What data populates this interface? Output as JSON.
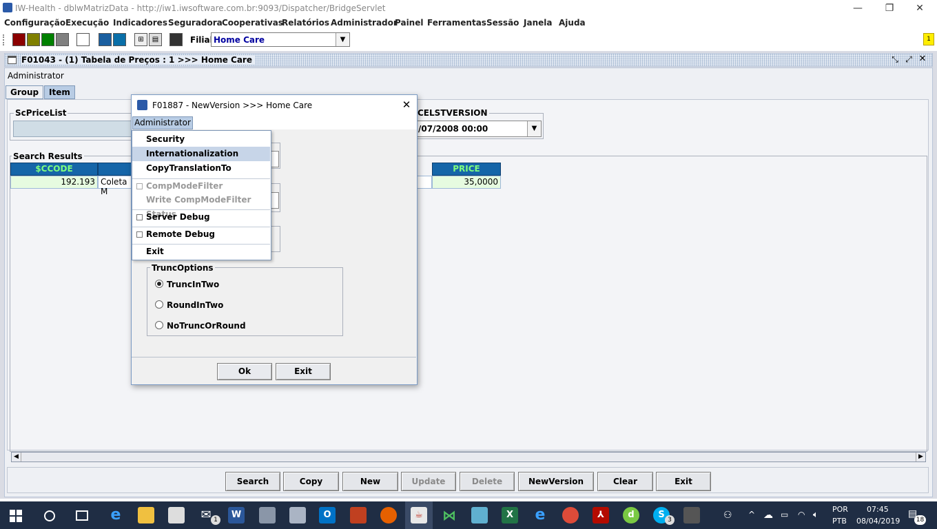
{
  "window": {
    "title": "IW-Health - dblwMatrizData - http://iw1.iwsoftware.com.br:9093/Dispatcher/BridgeServlet",
    "minimize": "—",
    "restore": "❐",
    "close": "✕"
  },
  "menubar": [
    "Configuração",
    "Execução",
    "Indicadores",
    "Seguradora",
    "Cooperativas",
    "Relatórios",
    "Administrador",
    "Painel",
    "Ferramentas",
    "Sessão",
    "Janela",
    "Ajuda"
  ],
  "toolbar": {
    "swatch_colors": [
      "#8b0000",
      "#808000",
      "#008000",
      "#808080",
      "#ffffff",
      "#1a5fa0",
      "#0a6fa8"
    ],
    "filial_label": "Filial:",
    "filial_value": "Home Care",
    "notification_badge": "1"
  },
  "frame": {
    "title": "F01043 - (1) Tabela de Preços : 1 >>> Home Care",
    "role_label": "Administrator",
    "tabs": [
      "Group",
      "Item"
    ],
    "active_tab": "Item",
    "scpricelist_legend": "ScPriceList",
    "version_legend": "CELSTVERSION",
    "version_value": "/07/2008 00:00",
    "results_legend": "Search Results",
    "columns": {
      "code": "$CCODE",
      "price": "PRICE"
    },
    "rows": [
      {
        "code": "192.193",
        "name": "Coleta M",
        "price": "35,0000"
      }
    ]
  },
  "buttons": {
    "search": "Search",
    "copy": "Copy",
    "new": "New",
    "update": "Update",
    "delete": "Delete",
    "newversion": "NewVersion",
    "clear": "Clear",
    "exit": "Exit"
  },
  "dialog": {
    "title": "F01887 - NewVersion >>> Home Care",
    "menu_label": "Administrator",
    "menu_items": {
      "security": "Security",
      "internationalization": "Internationalization",
      "copy_translation": "CopyTranslationTo",
      "comp_mode_filter": "CompModeFilter",
      "write_comp_mode": "Write CompModeFilter Status",
      "server_debug": "Server Debug",
      "remote_debug": "Remote Debug",
      "exit": "Exit"
    },
    "trunc_legend": "TruncOptions",
    "radios": {
      "trunc_in_two": "TruncInTwo",
      "round_in_two": "RoundInTwo",
      "no_trunc": "NoTruncOrRound"
    },
    "ok": "Ok",
    "exit": "Exit"
  },
  "taskbar": {
    "mail_badge": "1",
    "skype_badge": "3",
    "lang": "POR",
    "layout": "PTB",
    "time": "07:45",
    "date": "08/04/2019",
    "notifications": "18"
  }
}
